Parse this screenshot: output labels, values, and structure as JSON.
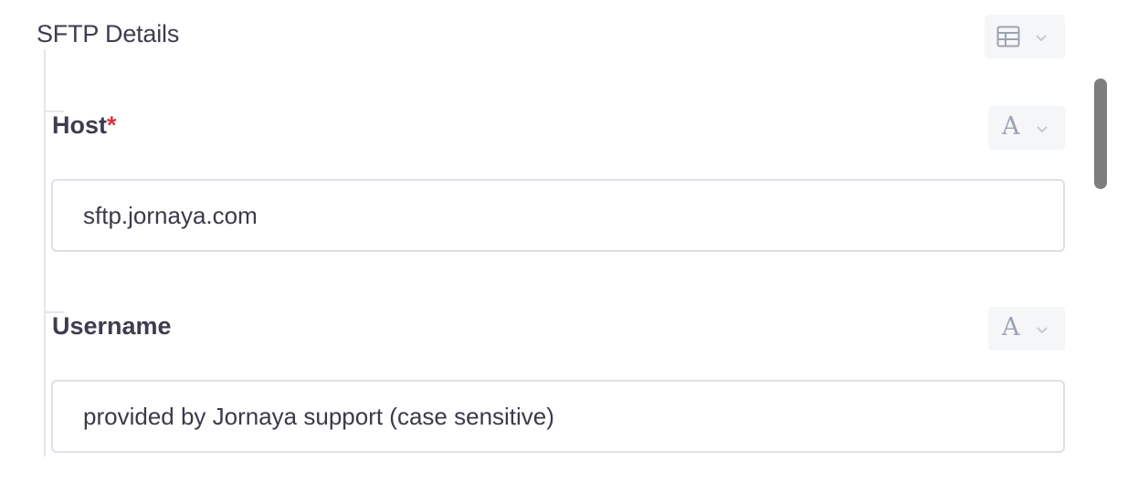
{
  "section": {
    "title": "SFTP Details",
    "type_icon": "table-icon"
  },
  "fields": [
    {
      "label": "Host",
      "required": "*",
      "type_glyph": "A",
      "value": "sftp.jornaya.com"
    },
    {
      "label": "Username",
      "type_glyph": "A",
      "value": "provided by Jornaya support (case sensitive)"
    }
  ],
  "colors": {
    "required": "#d9363e",
    "icon": "#9aa3b2",
    "scrollbar": "#7d7d7d"
  }
}
